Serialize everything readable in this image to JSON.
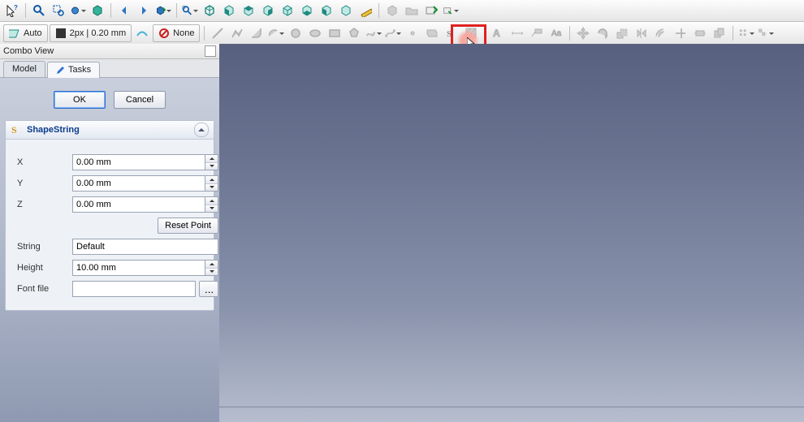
{
  "panel": {
    "title": "Combo View"
  },
  "tabs": {
    "model": "Model",
    "tasks": "Tasks"
  },
  "dialog": {
    "ok": "OK",
    "cancel": "Cancel"
  },
  "task": {
    "title": "ShapeString",
    "x_label": "X",
    "x_value": "0.00 mm",
    "y_label": "Y",
    "y_value": "0.00 mm",
    "z_label": "Z",
    "z_value": "0.00 mm",
    "reset": "Reset Point",
    "string_label": "String",
    "string_value": "Default",
    "height_label": "Height",
    "height_value": "10.00 mm",
    "fontfile_label": "Font file",
    "fontfile_value": "",
    "browse": "..."
  },
  "toolbar2": {
    "auto": "Auto",
    "linewidth": "2px | 0.20 mm",
    "none": "None"
  }
}
